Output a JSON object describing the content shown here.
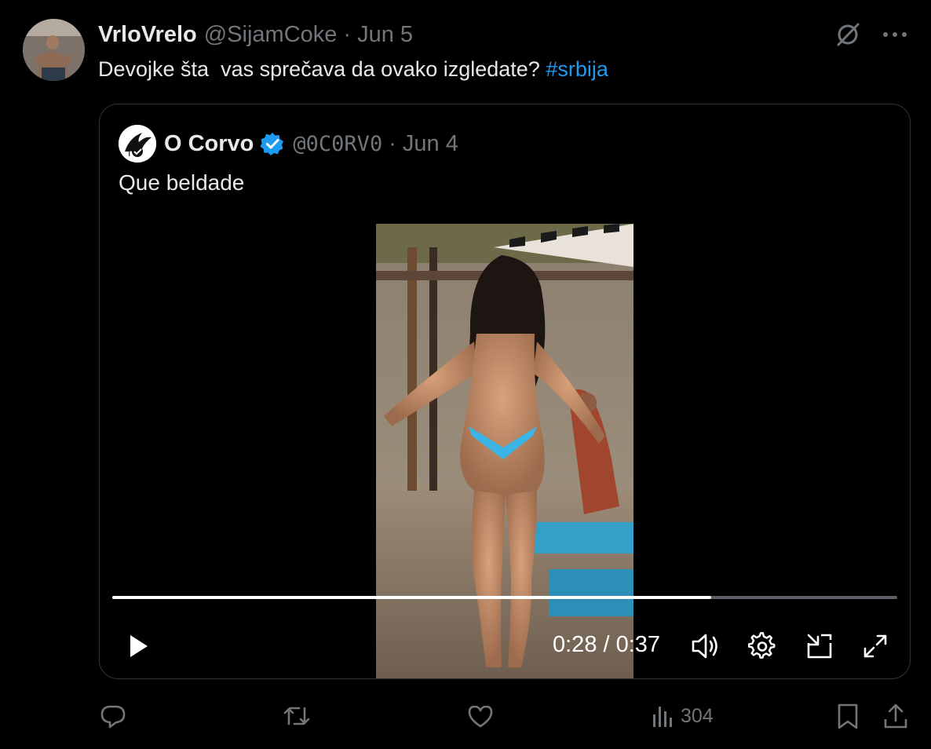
{
  "tweet": {
    "author_name": "VrloVrelo",
    "author_handle": "@SijamCoke",
    "separator": "·",
    "date": "Jun 5",
    "text_main": "Devojke šta  vas sprečava da ovako izgledate? ",
    "hashtag": "#srbija"
  },
  "quoted": {
    "author_name": "O Corvo",
    "author_handle": "@0C0RV0",
    "separator": "·",
    "date": "Jun 4",
    "text": "Que beldade",
    "verified_color": "#1d9bf0"
  },
  "video": {
    "time_display": "0:28 / 0:37",
    "progress": 0.763
  },
  "actions": {
    "views_count": "304"
  },
  "icons": [
    "grok-icon",
    "more-icon",
    "play-icon",
    "volume-icon",
    "settings-icon",
    "pip-icon",
    "fullscreen-icon",
    "reply-icon",
    "retweet-icon",
    "like-icon",
    "views-icon",
    "bookmark-icon",
    "share-icon"
  ],
  "colors": {
    "accent": "#1d9bf0",
    "secondary_text": "#71767b",
    "border": "#2f3336"
  }
}
